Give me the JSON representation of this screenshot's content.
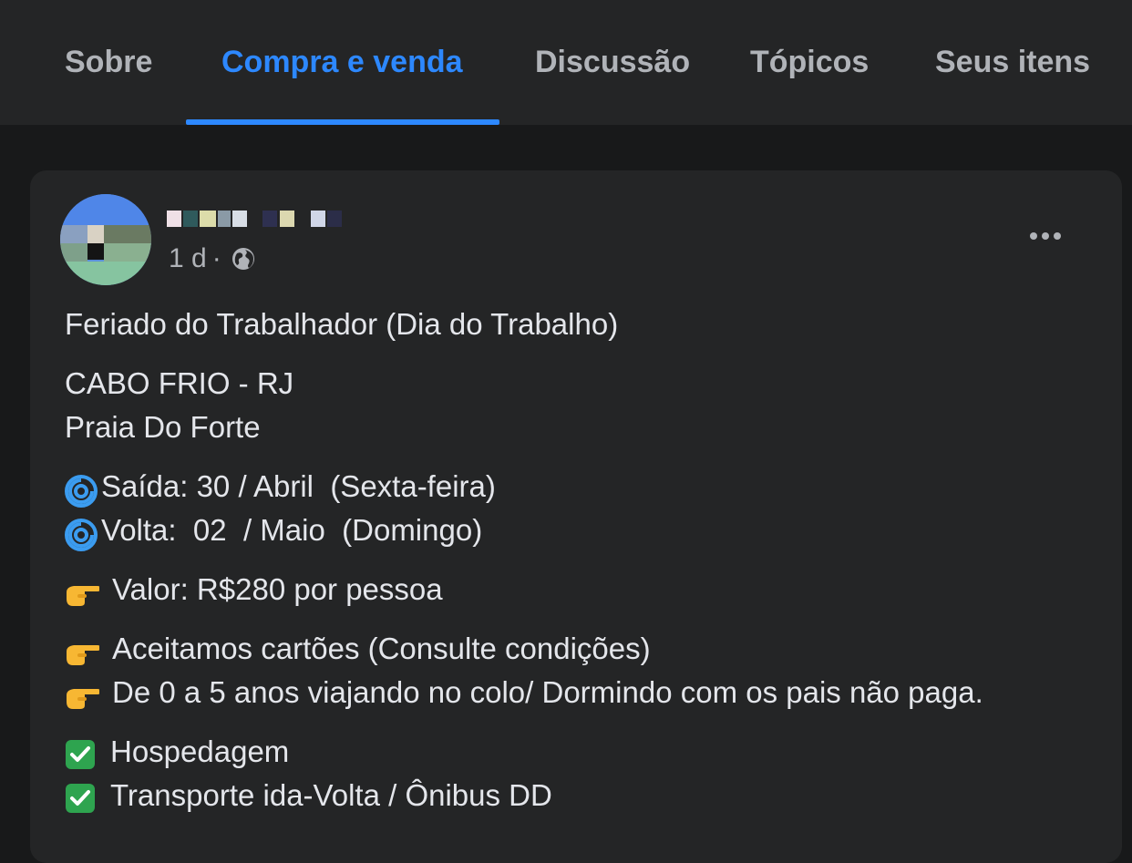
{
  "tabs": [
    {
      "label": "Sobre",
      "active": false
    },
    {
      "label": "Compra e venda",
      "active": true
    },
    {
      "label": "Discussão",
      "active": false
    },
    {
      "label": "Tópicos",
      "active": false
    },
    {
      "label": "Seus itens",
      "active": false
    }
  ],
  "post": {
    "time": "1 d",
    "separator": "·",
    "privacy_icon": "globe-icon",
    "more_icon": "more-options-icon",
    "lines": {
      "title": "Feriado do Trabalhador (Dia do Trabalho)",
      "city": "CABO FRIO - RJ",
      "beach": "Praia Do Forte",
      "departure": "Saída: 30 / Abril  (Sexta-feira)",
      "return": "Volta:  02  / Maio  (Domingo)",
      "price": "Valor: R$280 por pessoa",
      "cards": "Aceitamos cartões (Consulte condições)",
      "kids": "De 0 a 5 anos viajando no colo/ Dormindo com os pais não paga.",
      "lodging": "Hospedagem",
      "transport": "Transporte ida-Volta / Ônibus DD"
    }
  },
  "colors": {
    "background": "#18191a",
    "surface": "#242526",
    "accent": "#2d88ff",
    "text_primary": "#e4e6eb",
    "text_secondary": "#b0b3b8",
    "check_green": "#2ea44f"
  }
}
